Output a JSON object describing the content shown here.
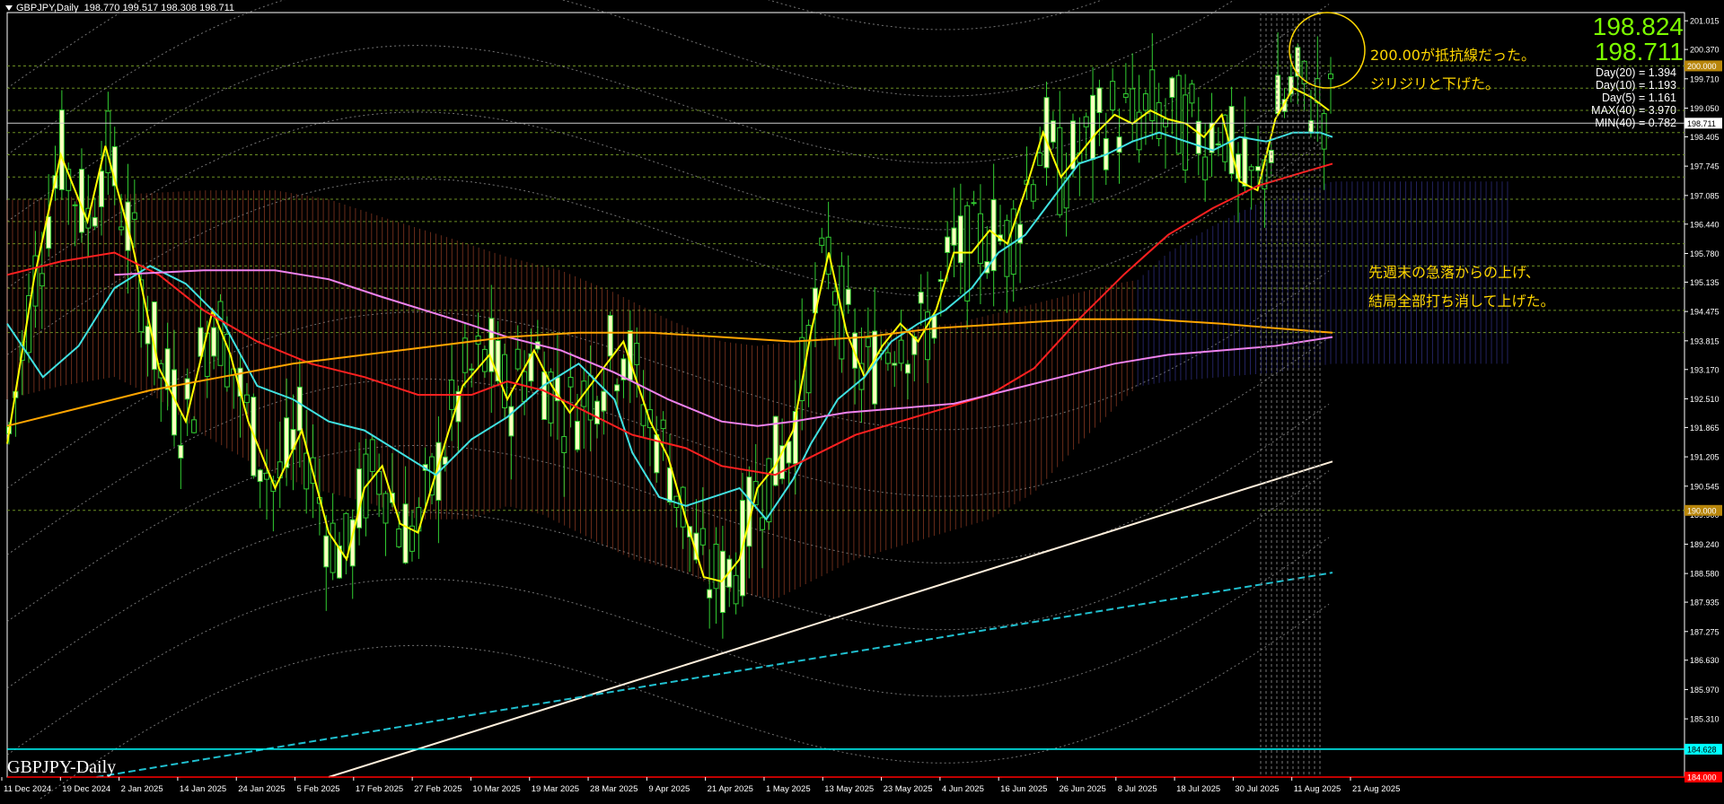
{
  "header": {
    "title": "GBPJPY,Daily",
    "ohlc": "198.770 199.517 198.308 198.711"
  },
  "symbol_label": "GBPJPY-Daily",
  "price_panel": {
    "bid": "198.824",
    "ask": "198.711",
    "stats": [
      "Day(20) = 1.394",
      "Day(10) = 1.193",
      "Day(5) = 1.161",
      "MAX(40) = 3.970",
      "MIN(40) = 0.782"
    ]
  },
  "annotations": {
    "note1_line1": "200.00が抵抗線だった。",
    "note1_line2": "ジリジリと下げた。",
    "note2_line1": "先週末の急落からの上げ、",
    "note2_line2": "結局全部打ち消して上げた。"
  },
  "colors": {
    "background": "#000000",
    "candle_bull": "#FFFFC0",
    "candle_bear": "#32CD32",
    "ma_fast": "#FFFF00",
    "ma_mid": "#40E0E0",
    "ma_slow": "#FF2020",
    "ma_long": "#EE82EE",
    "ma_yearly": "#FFA500",
    "trend_white": "#FFF0DC",
    "trend_cyan": "#20C0D0",
    "cloud_up": "#4040B0",
    "cloud_down": "#C05030",
    "grid_level": "#6B8E23",
    "band_dotted": "#909090",
    "price_line_cyan": "#00FFFF",
    "price_line_red": "#FF0000",
    "annotation": "#FFD700",
    "circle": "#FFD700"
  },
  "chart_data": {
    "type": "candlestick",
    "title": "GBPJPY,Daily",
    "symbol": "GBPJPY",
    "timeframe": "Daily",
    "ylim": [
      184.0,
      201.2
    ],
    "y_ticks": [
      "201.015",
      "200.370",
      "199.710",
      "199.050",
      "198.405",
      "197.745",
      "197.085",
      "196.440",
      "195.780",
      "195.135",
      "194.475",
      "193.815",
      "193.170",
      "192.510",
      "191.865",
      "191.205",
      "190.545",
      "189.900",
      "189.240",
      "188.580",
      "187.935",
      "187.275",
      "186.630",
      "185.970",
      "185.310",
      "184.650"
    ],
    "x_tick_labels": [
      "11 Dec 2024",
      "19 Dec 2024",
      "2 Jan 2025",
      "14 Jan 2025",
      "24 Jan 2025",
      "5 Feb 2025",
      "17 Feb 2025",
      "27 Feb 2025",
      "10 Mar 2025",
      "19 Mar 2025",
      "28 Mar 2025",
      "9 Apr 2025",
      "21 Apr 2025",
      "1 May 2025",
      "13 May 2025",
      "23 May 2025",
      "4 Jun 2025",
      "16 Jun 2025",
      "26 Jun 2025",
      "8 Jul 2025",
      "18 Jul 2025",
      "30 Jul 2025",
      "11 Aug 2025",
      "21 Aug 2025"
    ],
    "price_labels": [
      {
        "value": 200.0,
        "text": "200.000"
      },
      {
        "value": 198.711,
        "text": "198.711"
      },
      {
        "value": 190.0,
        "text": "190.000"
      },
      {
        "value": 184.628,
        "text": "184.628"
      },
      {
        "value": 184.0,
        "text": "184.000"
      }
    ],
    "horizontal_levels": [
      200.0,
      199.5,
      199.0,
      198.5,
      198.0,
      197.5,
      197.0,
      196.5,
      196.0,
      195.5,
      195.0,
      194.5,
      194.0,
      190.0
    ],
    "moving_averages": [
      {
        "color_key": "ma_fast",
        "points": [
          [
            0,
            191.5
          ],
          [
            30,
            195.2
          ],
          [
            60,
            198.0
          ],
          [
            90,
            196.5
          ],
          [
            110,
            198.2
          ],
          [
            140,
            196.0
          ],
          [
            170,
            193.2
          ],
          [
            200,
            192.0
          ],
          [
            230,
            194.5
          ],
          [
            250,
            193.5
          ],
          [
            270,
            192.0
          ],
          [
            300,
            190.5
          ],
          [
            330,
            191.8
          ],
          [
            360,
            189.5
          ],
          [
            380,
            188.9
          ],
          [
            400,
            190.5
          ],
          [
            420,
            191.0
          ],
          [
            440,
            189.7
          ],
          [
            460,
            189.5
          ],
          [
            490,
            191.5
          ],
          [
            510,
            192.8
          ],
          [
            540,
            193.5
          ],
          [
            560,
            192.5
          ],
          [
            590,
            193.6
          ],
          [
            610,
            192.8
          ],
          [
            630,
            192.2
          ],
          [
            660,
            193.0
          ],
          [
            690,
            193.8
          ],
          [
            720,
            192.0
          ],
          [
            740,
            191.2
          ],
          [
            760,
            189.8
          ],
          [
            780,
            188.5
          ],
          [
            800,
            188.4
          ],
          [
            820,
            188.9
          ],
          [
            840,
            190.5
          ],
          [
            860,
            191.0
          ],
          [
            880,
            191.8
          ],
          [
            900,
            194.0
          ],
          [
            920,
            195.8
          ],
          [
            940,
            194.0
          ],
          [
            960,
            193.0
          ],
          [
            980,
            193.7
          ],
          [
            1000,
            194.2
          ],
          [
            1020,
            193.8
          ],
          [
            1040,
            194.5
          ],
          [
            1060,
            195.8
          ],
          [
            1080,
            195.8
          ],
          [
            1100,
            196.3
          ],
          [
            1120,
            196.0
          ],
          [
            1140,
            197.2
          ],
          [
            1160,
            198.5
          ],
          [
            1180,
            197.5
          ],
          [
            1200,
            198.0
          ],
          [
            1220,
            198.5
          ],
          [
            1240,
            198.9
          ],
          [
            1260,
            198.7
          ],
          [
            1280,
            199.0
          ],
          [
            1300,
            198.8
          ],
          [
            1320,
            198.7
          ],
          [
            1340,
            198.4
          ],
          [
            1360,
            198.9
          ],
          [
            1380,
            197.4
          ],
          [
            1400,
            197.2
          ],
          [
            1420,
            198.8
          ],
          [
            1440,
            199.5
          ],
          [
            1460,
            199.3
          ],
          [
            1480,
            199.0
          ]
        ]
      },
      {
        "color_key": "ma_mid",
        "points": [
          [
            0,
            194.2
          ],
          [
            40,
            193.0
          ],
          [
            80,
            193.7
          ],
          [
            120,
            195.0
          ],
          [
            160,
            195.5
          ],
          [
            200,
            195.1
          ],
          [
            240,
            194.3
          ],
          [
            280,
            192.8
          ],
          [
            320,
            192.5
          ],
          [
            360,
            192.0
          ],
          [
            400,
            191.8
          ],
          [
            440,
            191.3
          ],
          [
            480,
            190.8
          ],
          [
            520,
            191.6
          ],
          [
            560,
            192.1
          ],
          [
            600,
            192.8
          ],
          [
            640,
            193.3
          ],
          [
            680,
            192.5
          ],
          [
            700,
            191.3
          ],
          [
            730,
            190.3
          ],
          [
            760,
            190.1
          ],
          [
            790,
            190.3
          ],
          [
            820,
            190.5
          ],
          [
            850,
            189.8
          ],
          [
            880,
            190.7
          ],
          [
            900,
            191.5
          ],
          [
            930,
            192.5
          ],
          [
            960,
            193.0
          ],
          [
            990,
            193.8
          ],
          [
            1020,
            194.2
          ],
          [
            1050,
            194.5
          ],
          [
            1080,
            195.0
          ],
          [
            1110,
            195.8
          ],
          [
            1140,
            196.2
          ],
          [
            1170,
            197.0
          ],
          [
            1200,
            197.8
          ],
          [
            1230,
            198.0
          ],
          [
            1260,
            198.3
          ],
          [
            1290,
            198.5
          ],
          [
            1320,
            198.3
          ],
          [
            1350,
            198.1
          ],
          [
            1380,
            198.4
          ],
          [
            1410,
            198.3
          ],
          [
            1440,
            198.5
          ],
          [
            1470,
            198.5
          ],
          [
            1484,
            198.4
          ]
        ]
      },
      {
        "color_key": "ma_slow",
        "points": [
          [
            0,
            195.3
          ],
          [
            60,
            195.6
          ],
          [
            120,
            195.8
          ],
          [
            170,
            195.3
          ],
          [
            220,
            194.5
          ],
          [
            280,
            193.8
          ],
          [
            340,
            193.3
          ],
          [
            400,
            193.0
          ],
          [
            460,
            192.6
          ],
          [
            520,
            192.6
          ],
          [
            560,
            192.9
          ],
          [
            600,
            192.7
          ],
          [
            650,
            192.2
          ],
          [
            700,
            191.7
          ],
          [
            760,
            191.4
          ],
          [
            800,
            191.0
          ],
          [
            860,
            190.8
          ],
          [
            900,
            191.2
          ],
          [
            950,
            191.7
          ],
          [
            1000,
            192.0
          ],
          [
            1050,
            192.3
          ],
          [
            1100,
            192.6
          ],
          [
            1150,
            193.2
          ],
          [
            1200,
            194.3
          ],
          [
            1250,
            195.3
          ],
          [
            1300,
            196.2
          ],
          [
            1350,
            196.8
          ],
          [
            1400,
            197.3
          ],
          [
            1450,
            197.6
          ],
          [
            1484,
            197.8
          ]
        ]
      },
      {
        "color_key": "ma_long",
        "points": [
          [
            120,
            195.3
          ],
          [
            220,
            195.4
          ],
          [
            300,
            195.4
          ],
          [
            360,
            195.2
          ],
          [
            420,
            194.8
          ],
          [
            500,
            194.3
          ],
          [
            560,
            193.9
          ],
          [
            620,
            193.6
          ],
          [
            680,
            193.1
          ],
          [
            740,
            192.5
          ],
          [
            800,
            192.0
          ],
          [
            840,
            191.9
          ],
          [
            880,
            192.0
          ],
          [
            940,
            192.2
          ],
          [
            1000,
            192.3
          ],
          [
            1060,
            192.4
          ],
          [
            1120,
            192.7
          ],
          [
            1180,
            193.0
          ],
          [
            1240,
            193.3
          ],
          [
            1300,
            193.5
          ],
          [
            1360,
            193.6
          ],
          [
            1420,
            193.7
          ],
          [
            1484,
            193.9
          ]
        ]
      },
      {
        "color_key": "ma_yearly",
        "points": [
          [
            0,
            191.9
          ],
          [
            80,
            192.3
          ],
          [
            160,
            192.7
          ],
          [
            240,
            193.0
          ],
          [
            320,
            193.3
          ],
          [
            400,
            193.5
          ],
          [
            480,
            193.7
          ],
          [
            560,
            193.9
          ],
          [
            640,
            194.0
          ],
          [
            720,
            194.0
          ],
          [
            800,
            193.9
          ],
          [
            880,
            193.8
          ],
          [
            960,
            193.9
          ],
          [
            1040,
            194.1
          ],
          [
            1120,
            194.2
          ],
          [
            1200,
            194.3
          ],
          [
            1280,
            194.3
          ],
          [
            1360,
            194.2
          ],
          [
            1420,
            194.1
          ],
          [
            1484,
            194.0
          ]
        ]
      }
    ],
    "trend_lines": [
      {
        "color_key": "trend_white",
        "from": [
          360,
          184.0
        ],
        "to": [
          1484,
          191.1
        ]
      },
      {
        "color_key": "trend_cyan",
        "from": [
          100,
          184.0
        ],
        "to": [
          1484,
          188.6
        ],
        "dashed": true
      }
    ]
  }
}
